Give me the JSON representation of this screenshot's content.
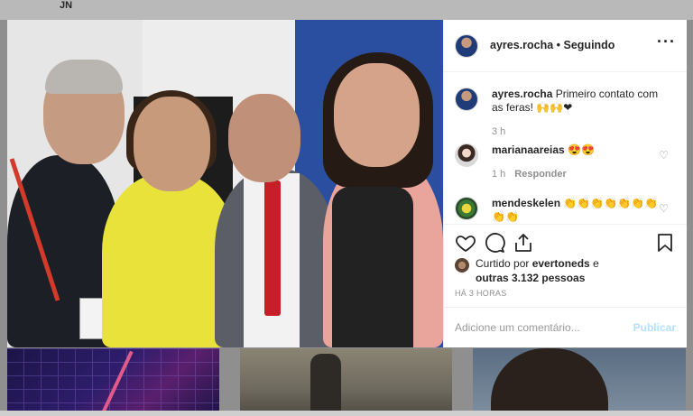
{
  "page": {
    "top_label": "JN"
  },
  "post": {
    "username": "ayres.rocha",
    "follow_status": "Seguindo",
    "header_text": "ayres.rocha • Seguindo",
    "caption": {
      "username": "ayres.rocha",
      "text": " Primeiro contato com as feras! 🙌🙌❤",
      "time": "3 h"
    },
    "comments": [
      {
        "username": "marianaareias",
        "text": " 😍😍",
        "time": "1 h",
        "reply_label": "Responder"
      },
      {
        "username": "mendeskelen",
        "text": " 👏👏👏👏👏👏👏👏👏",
        "time": "",
        "reply_label": ""
      }
    ],
    "likes": {
      "prefix": "Curtido por ",
      "first_user": "evertoneds",
      "connector": " e",
      "others": "outras 3.132 pessoas"
    },
    "timestamp": "HÁ 3 HORAS",
    "add_comment_placeholder": "Adicione um comentário...",
    "publish_label": "Publicar"
  },
  "icons": {
    "more": "more-options-icon",
    "like": "heart-icon",
    "comment": "comment-icon",
    "share": "share-icon",
    "save": "bookmark-icon"
  }
}
